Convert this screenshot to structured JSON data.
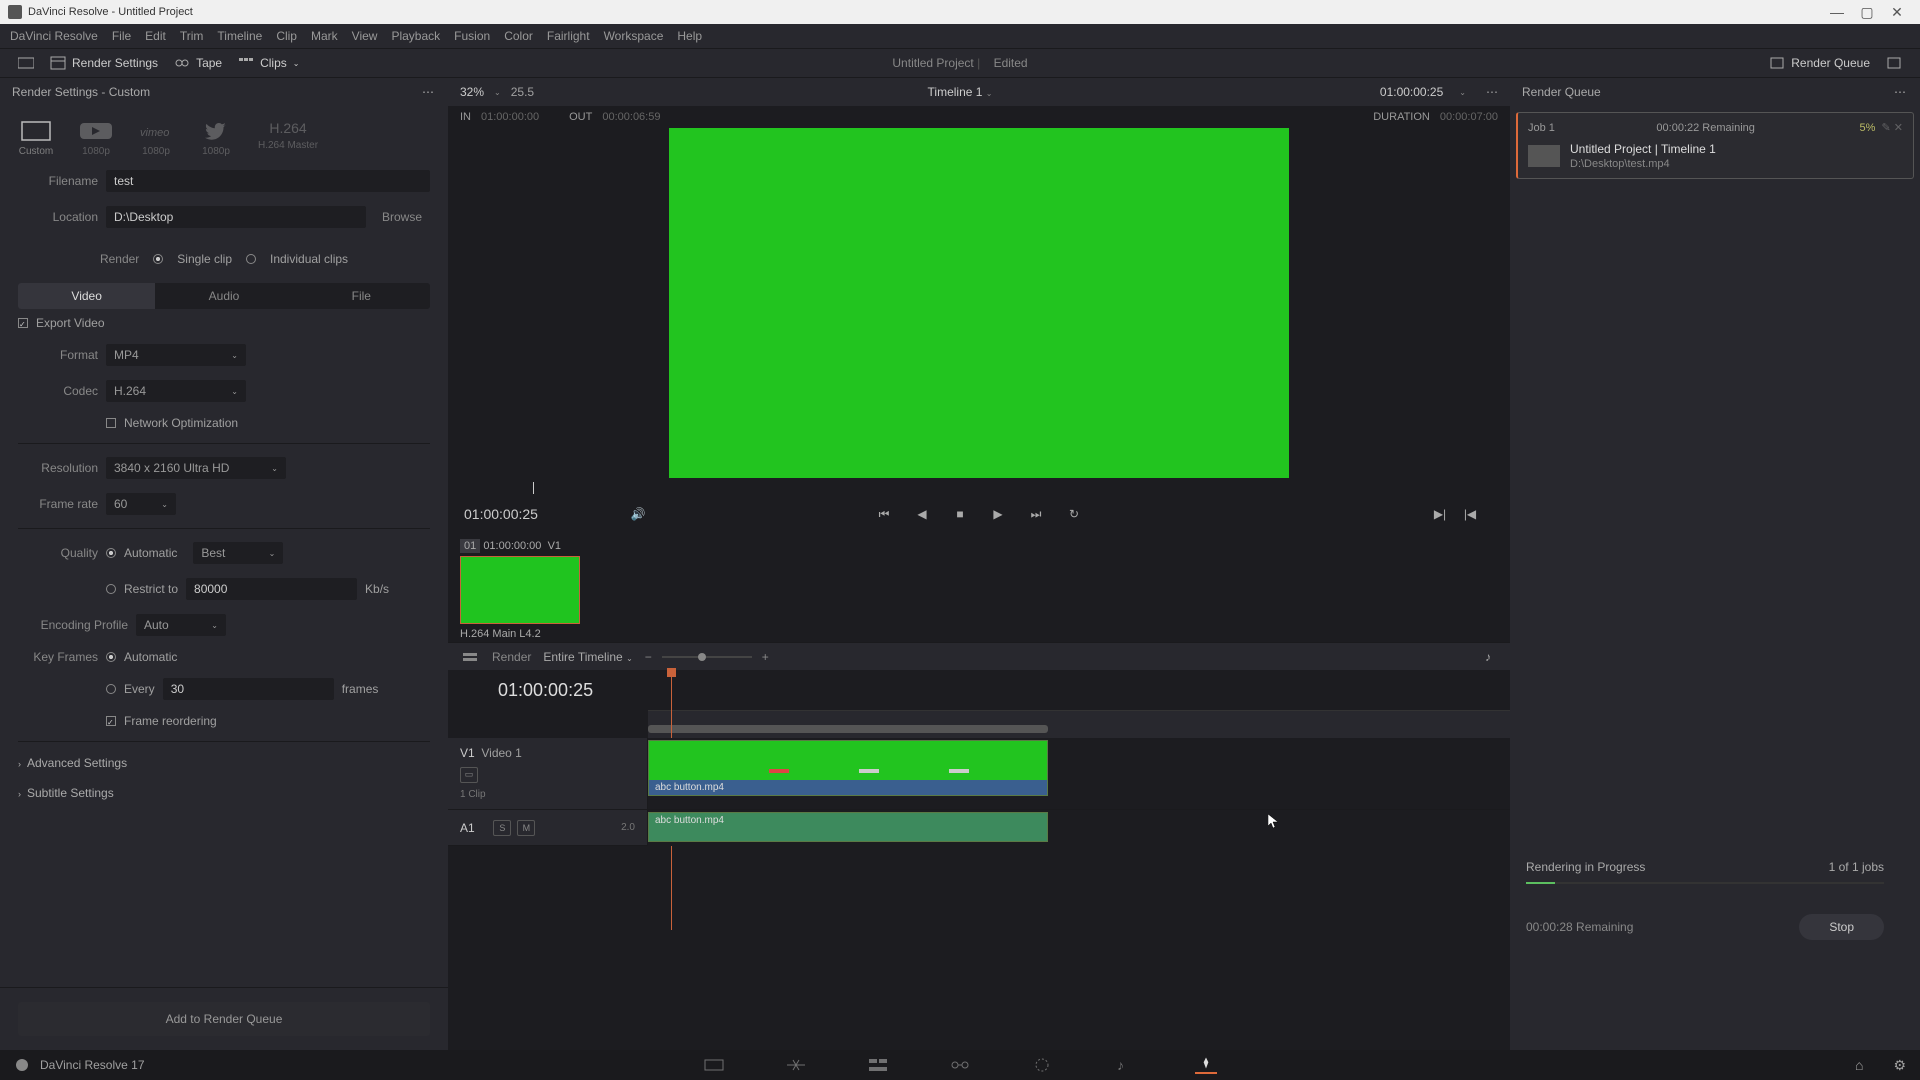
{
  "titlebar": {
    "text": "DaVinci Resolve - Untitled Project"
  },
  "menubar": [
    "DaVinci Resolve",
    "File",
    "Edit",
    "Trim",
    "Timeline",
    "Clip",
    "Mark",
    "View",
    "Playback",
    "Fusion",
    "Color",
    "Fairlight",
    "Workspace",
    "Help"
  ],
  "toolbar": {
    "render_settings": "Render Settings",
    "tape": "Tape",
    "clips": "Clips",
    "project": "Untitled Project",
    "edited": "Edited",
    "render_queue": "Render Queue"
  },
  "left": {
    "title": "Render Settings - Custom",
    "presets": [
      {
        "name": "Custom",
        "sub": "Custom"
      },
      {
        "name": "YouTube",
        "sub": "1080p"
      },
      {
        "name": "Vimeo",
        "sub": "1080p"
      },
      {
        "name": "Twitter",
        "sub": "1080p"
      },
      {
        "name": "H.264",
        "sub": "H.264 Master"
      }
    ],
    "filename_label": "Filename",
    "filename": "test",
    "location_label": "Location",
    "location": "D:\\Desktop",
    "browse": "Browse",
    "render_label": "Render",
    "single_clip": "Single clip",
    "individual_clips": "Individual clips",
    "tabs": [
      "Video",
      "Audio",
      "File"
    ],
    "export_video": "Export Video",
    "format_label": "Format",
    "format": "MP4",
    "codec_label": "Codec",
    "codec": "H.264",
    "network_opt": "Network Optimization",
    "resolution_label": "Resolution",
    "resolution": "3840 x 2160 Ultra HD",
    "framerate_label": "Frame rate",
    "framerate": "60",
    "quality_label": "Quality",
    "quality_auto": "Automatic",
    "quality_best": "Best",
    "restrict_label": "Restrict to",
    "restrict_val": "80000",
    "restrict_unit": "Kb/s",
    "encoding_label": "Encoding Profile",
    "encoding": "Auto",
    "keyframes_label": "Key Frames",
    "keyframes_auto": "Automatic",
    "keyframes_every": "Every",
    "keyframes_val": "30",
    "keyframes_unit": "frames",
    "frame_reorder": "Frame reordering",
    "advanced": "Advanced Settings",
    "subtitle": "Subtitle Settings",
    "add_queue": "Add to Render Queue"
  },
  "viewer": {
    "zoom": "32%",
    "fps": "25.5",
    "timeline_name": "Timeline 1",
    "timecode": "01:00:00:25",
    "in_label": "IN",
    "in_val": "01:00:00:00",
    "out_label": "OUT",
    "out_val": "00:00:06:59",
    "duration_label": "DURATION",
    "duration_val": "00:00:07:00",
    "tc_display": "01:00:00:25"
  },
  "thumb": {
    "idx": "01",
    "tc": "01:00:00:00",
    "track": "V1",
    "codec": "H.264 Main L4.2"
  },
  "tltoolbar": {
    "render": "Render",
    "scope": "Entire Timeline"
  },
  "timeline": {
    "tc": "01:00:00:25",
    "v1_id": "V1",
    "v1_name": "Video 1",
    "v1_clips": "1 Clip",
    "a1_id": "A1",
    "a1_ch": "2.0",
    "clip_name": "abc button.mp4"
  },
  "queue": {
    "title": "Render Queue",
    "job_name": "Job 1",
    "job_remain": "00:00:22 Remaining",
    "job_pct": "5%",
    "job_title": "Untitled Project | Timeline 1",
    "job_path": "D:\\Desktop\\test.mp4",
    "progress_label": "Rendering in Progress",
    "progress_count": "1 of 1 jobs",
    "remaining": "00:00:28 Remaining",
    "stop": "Stop"
  },
  "footer": {
    "version": "DaVinci Resolve 17"
  }
}
